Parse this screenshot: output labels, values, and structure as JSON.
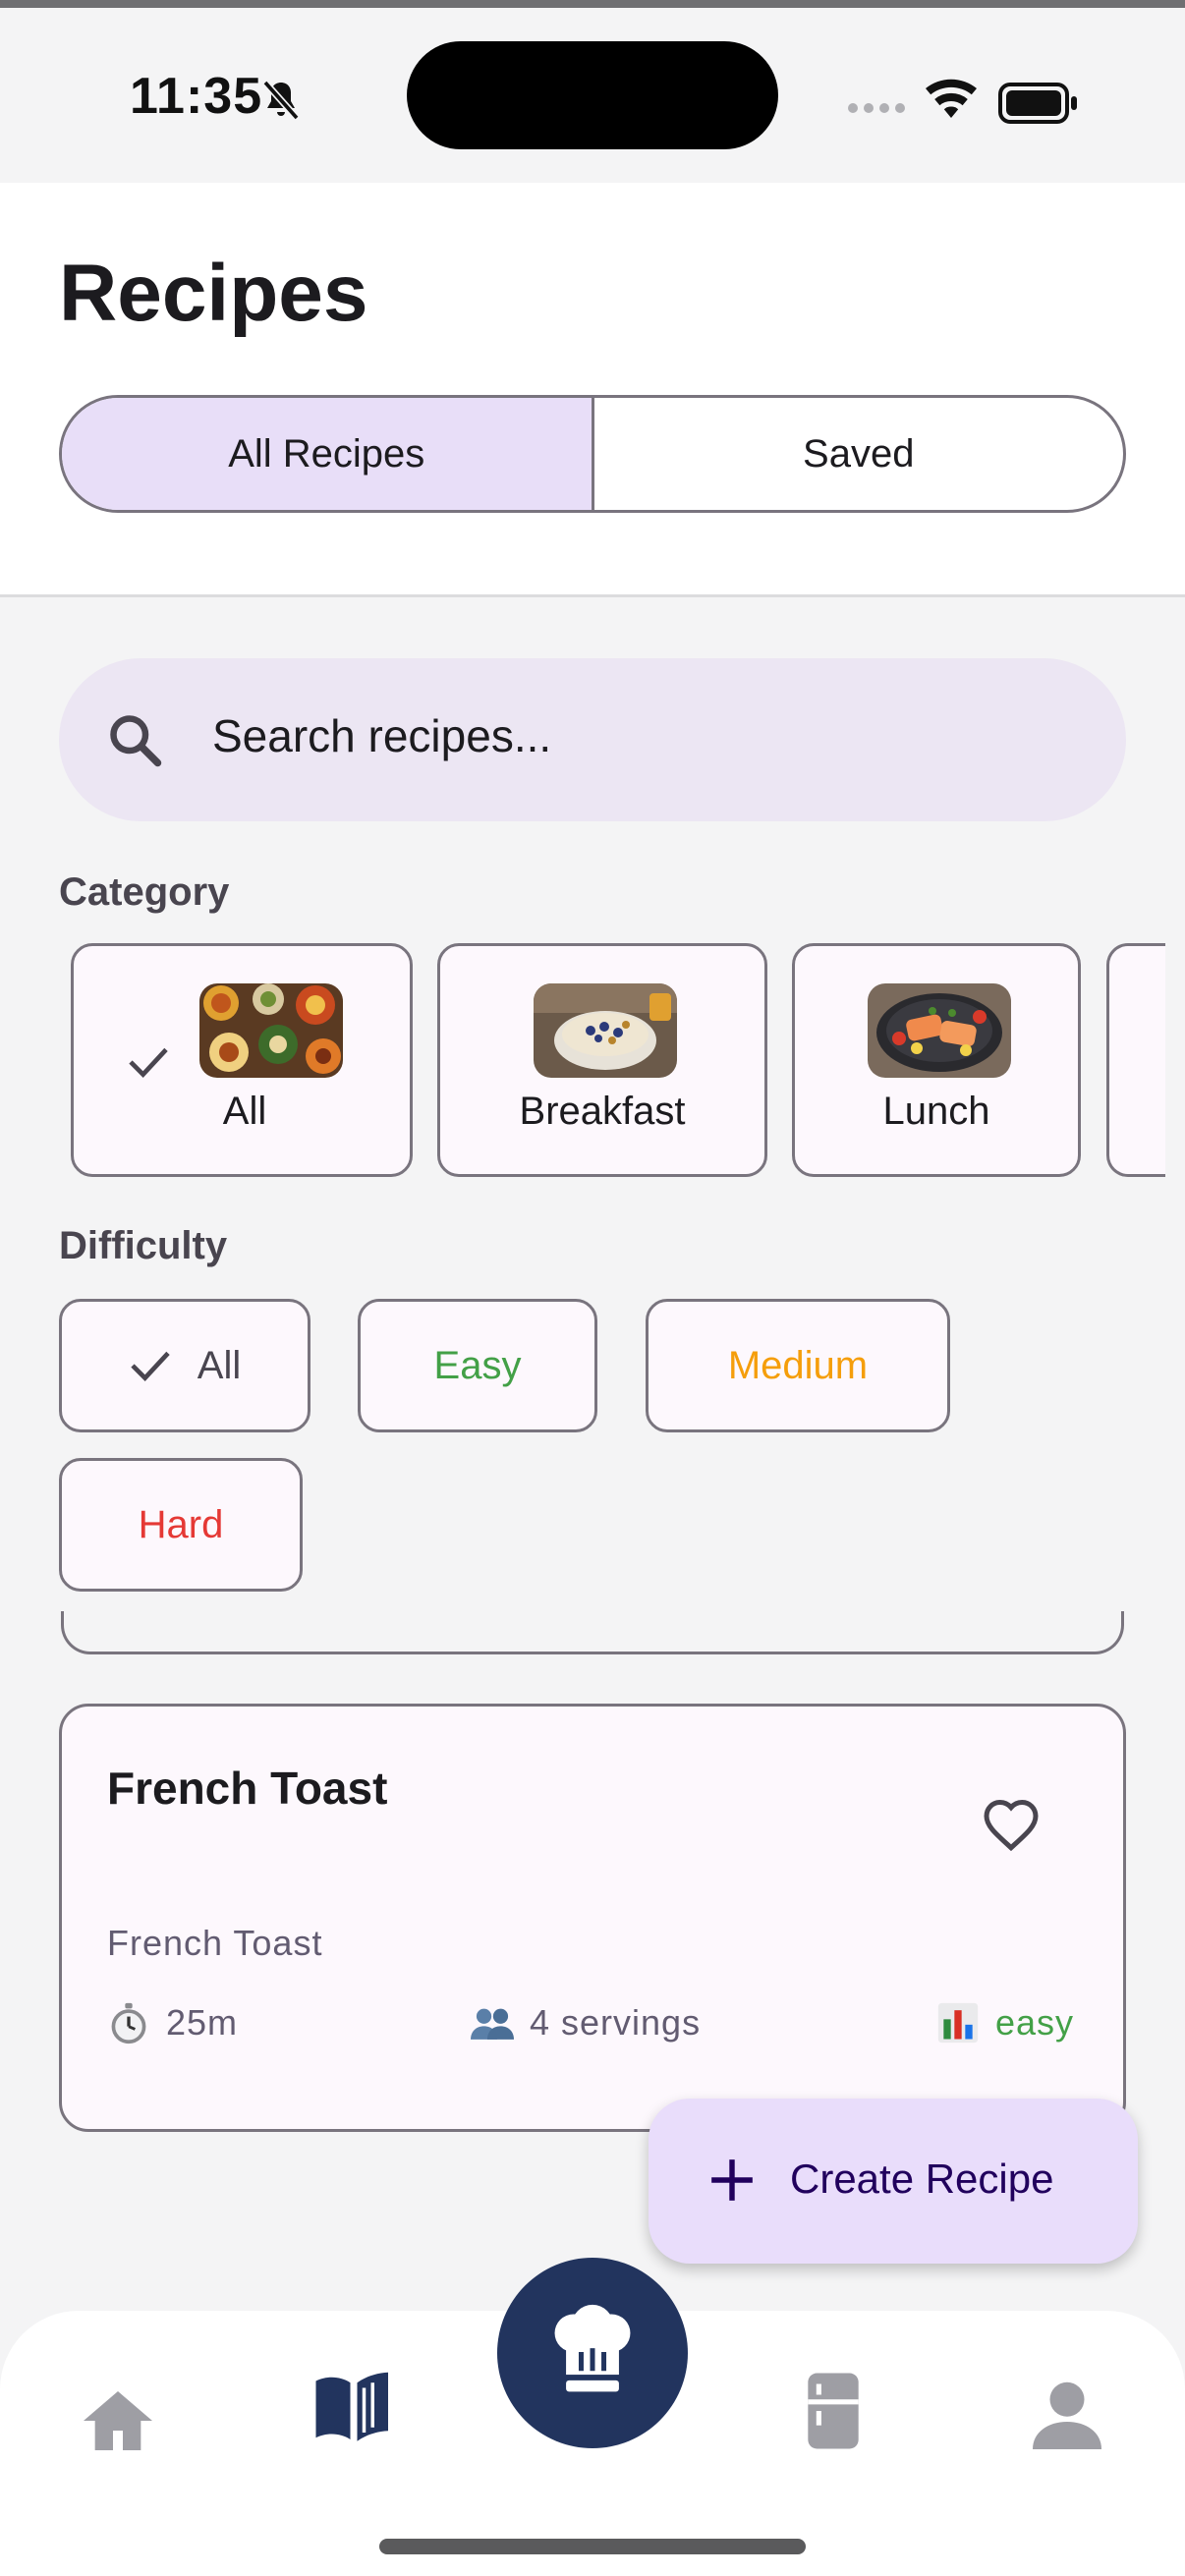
{
  "status_bar": {
    "time": "11:35",
    "icons": [
      "bell-slash-icon",
      "signal-dots-icon",
      "wifi-icon",
      "battery-icon"
    ]
  },
  "header": {
    "title": "Recipes",
    "tabs": [
      {
        "label": "All Recipes",
        "active": true
      },
      {
        "label": "Saved",
        "active": false
      }
    ]
  },
  "search": {
    "placeholder": "Search recipes..."
  },
  "category": {
    "label": "Category",
    "items": [
      {
        "label": "All",
        "selected": true,
        "icon": "food-spread-image"
      },
      {
        "label": "Breakfast",
        "selected": false,
        "icon": "oatmeal-bowl-image"
      },
      {
        "label": "Lunch",
        "selected": false,
        "icon": "salmon-plate-image"
      }
    ]
  },
  "difficulty": {
    "label": "Difficulty",
    "items": [
      {
        "label": "All",
        "selected": true,
        "color": "#49454f"
      },
      {
        "label": "Easy",
        "selected": false,
        "color": "#43a047"
      },
      {
        "label": "Medium",
        "selected": false,
        "color": "#f59e0b"
      },
      {
        "label": "Hard",
        "selected": false,
        "color": "#e53935"
      }
    ]
  },
  "recipe_card": {
    "title": "French Toast",
    "subtitle": "French Toast",
    "time": "25m",
    "servings": "4 servings",
    "difficulty": "easy",
    "difficulty_color": "#43a047",
    "favorite_icon": "heart-outline-icon"
  },
  "fab": {
    "label": "Create Recipe"
  },
  "bottom_nav": {
    "items": [
      "home-icon",
      "recipe-book-icon",
      "chef-hat-icon",
      "fridge-icon",
      "profile-icon"
    ],
    "active": "recipe-book-icon",
    "active_color": "#22345e",
    "inactive_color": "#9e9ea4"
  }
}
